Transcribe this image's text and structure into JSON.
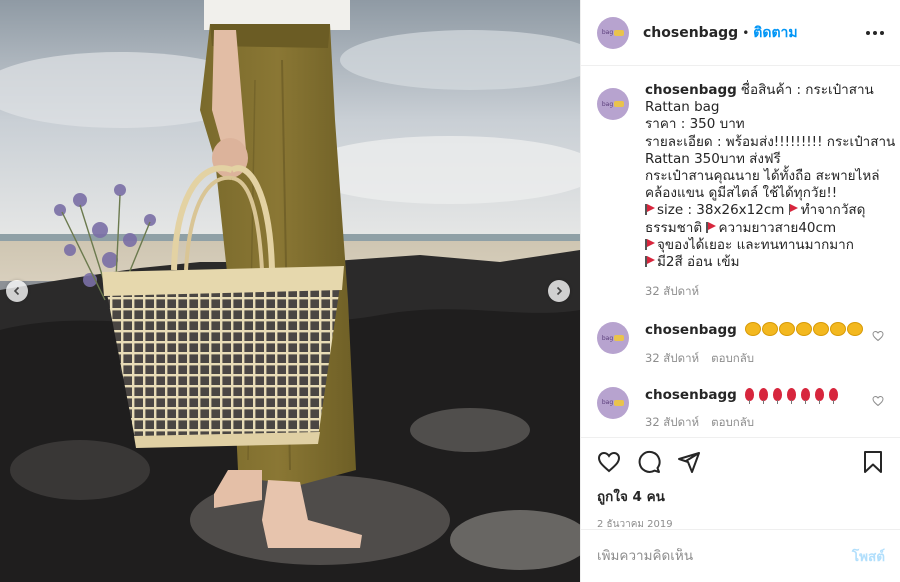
{
  "post": {
    "username": "chosenbagg",
    "follow_label": "ติดตาม",
    "caption_lines": [
      "ชื่อสินค้า : กระเป๋าสาน",
      "Rattan bag",
      "ราคา : 350 บาท",
      "รายละเอียด : พร้อมส่ง!!!!!!!!! กระเป๋าสาน",
      "Rattan 350บาท ส่งฟรี",
      "กระเป๋าสานคุณนาย ได้ทั้งถือ สะพายไหล่",
      "คล้องแขน ดูมีสไตล์ ใช้ได้ทุกวัย!!"
    ],
    "caption_flag_lines": [
      [
        "size : 38x26x12cm ",
        "ทำจากวัสดุ"
      ],
      [
        "ธรรมชาติ ",
        "ความยาวสาย40cm"
      ],
      [
        "จุของได้เยอะ และทนทานมากมาก"
      ],
      [
        "มี2สี อ่อน เข้ม"
      ]
    ],
    "caption_time": "32 สัปดาห์",
    "comments": [
      {
        "username": "chosenbagg",
        "emoji": "clapping-hands x7",
        "time": "32 สัปดาห์",
        "reply": "ตอบกลับ"
      },
      {
        "username": "chosenbagg",
        "emoji": "balloons x7",
        "time": "32 สัปดาห์",
        "reply": "ตอบกลับ"
      }
    ],
    "likes": "ถูกใจ 4 คน",
    "date": "2 ธันวาคม 2019",
    "add_comment_placeholder": "เพิ่มความคิดเห็น",
    "post_button": "โพสต์"
  },
  "icons": {
    "more": "more-options-icon",
    "like": "heart-icon",
    "comment": "comment-icon",
    "share": "share-icon",
    "save": "bookmark-icon",
    "prev": "chevron-left-icon",
    "next": "chevron-right-icon"
  },
  "colors": {
    "follow": "#0095f6",
    "post_disabled": "#b2dffc",
    "muted": "#8e8e8e",
    "avatar": "#b7a3cf"
  }
}
